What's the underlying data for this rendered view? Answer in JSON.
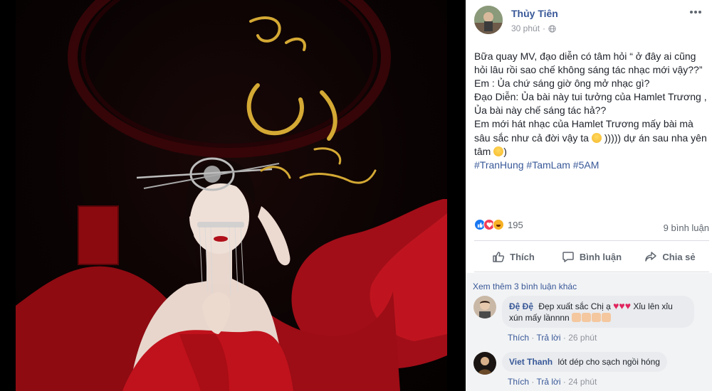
{
  "post": {
    "author": "Thủy Tiên",
    "time": "30 phút",
    "text_lines": [
      "Bữa quay MV, đạo diễn có tâm hỏi “ ở đây ai cũng",
      "hỏi lâu rồi sao chế không sáng tác nhạc mới vậy??”",
      "Em : Ủa chứ sáng giờ ông mở nhạc gì?",
      "Đạo Diễn: Ủa bài này tui tưởng của Hamlet Trương ,",
      "Ủa bài này chế sáng tác hả??",
      "Em mới hát nhạc của Hamlet Trương mấy bài mà"
    ],
    "text_line7_a": "sâu sắc như cả đời vậy ta",
    "text_line7_b": "))))) dự án sau nha yên",
    "text_line8": "tâm",
    "text_line8_end": ")",
    "hashtags": [
      "#TranHung",
      "#TamLam",
      "#5AM"
    ],
    "reaction_count": "195",
    "comment_count": "9 bình luận"
  },
  "actions": {
    "like": "Thích",
    "comment": "Bình luận",
    "share": "Chia sẻ"
  },
  "comments_section": {
    "more_link": "Xem thêm 3 bình luận khác",
    "comments": [
      {
        "name": "Đệ Đệ",
        "text_a": "Đẹp xuất sắc Chị ạ",
        "text_b": "Xỉu lên",
        "text_c": "xỉu xún mấy lầnnnn",
        "like": "Thích",
        "reply": "Trả lời",
        "time": "26 phút"
      },
      {
        "name": "Viet Thanh",
        "text": "lót dép cho sạch ngồi hóng",
        "like": "Thích",
        "reply": "Trả lời",
        "time": "24 phút"
      }
    ]
  },
  "photo": {
    "calligraphy_title": "Từng có người yêu tôi như sinh mệnh",
    "calligraphy_words": [
      "Từng",
      "có người",
      "yêu tôi",
      "như",
      "sinh mệnh"
    ],
    "stamp_text": "Thủy Tiên"
  },
  "colors": {
    "link": "#385898",
    "gold": "#d4a934",
    "red_dress": "#b0101a"
  }
}
